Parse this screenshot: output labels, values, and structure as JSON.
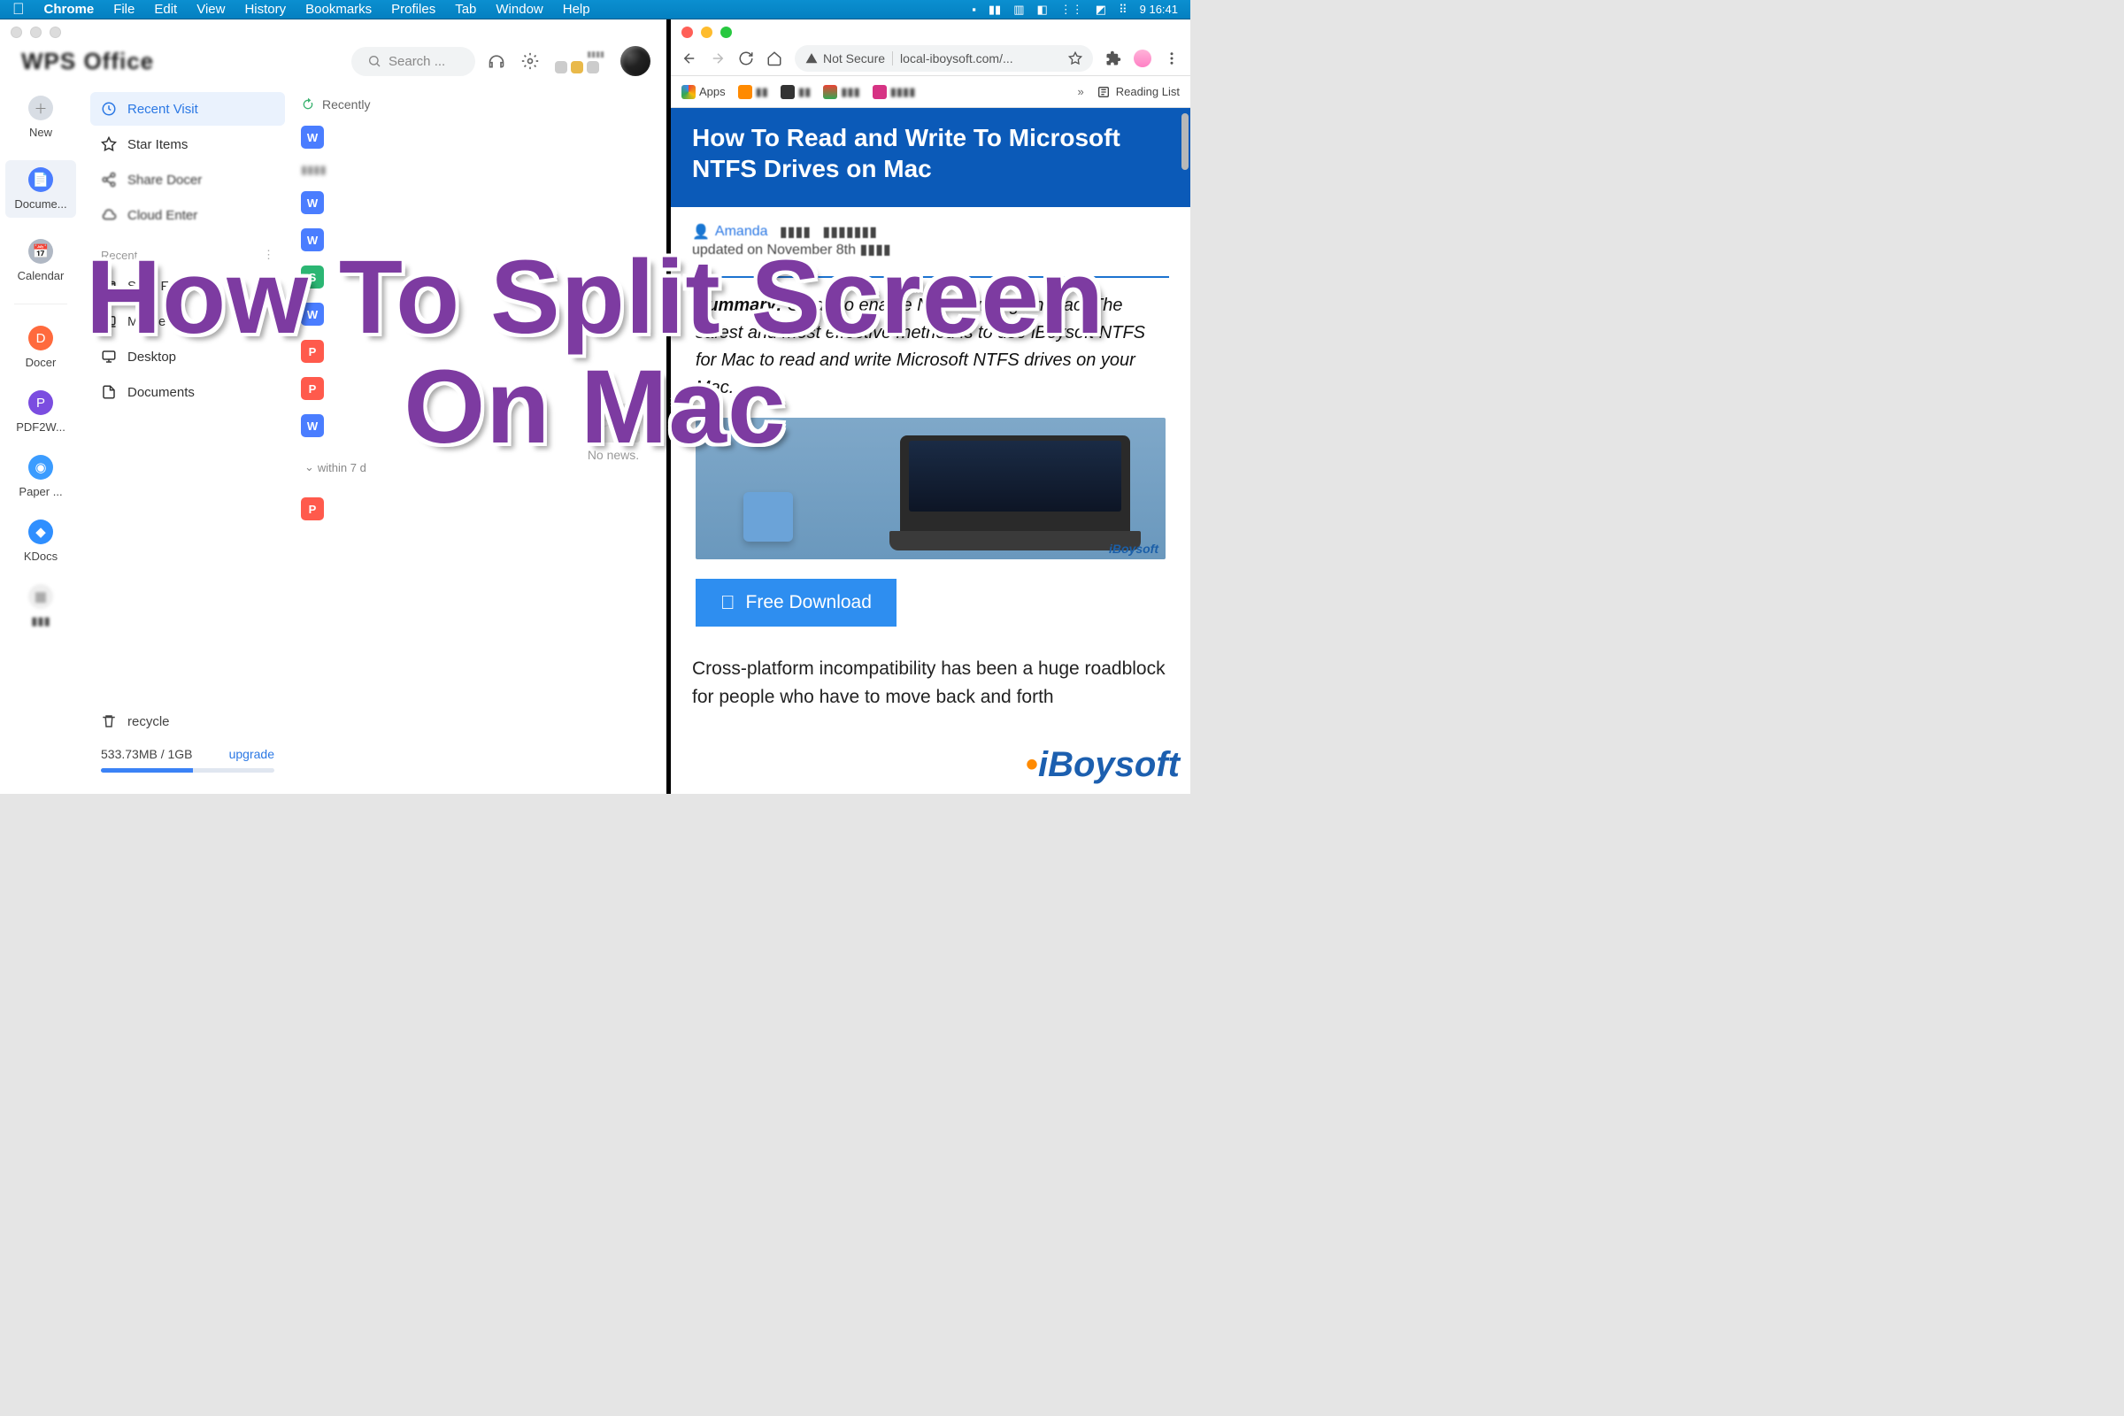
{
  "menubar": {
    "app": "Chrome",
    "items": [
      "File",
      "Edit",
      "View",
      "History",
      "Bookmarks",
      "Profiles",
      "Tab",
      "Window",
      "Help"
    ],
    "clock": "9 16:41"
  },
  "left": {
    "logo": "WPS Office",
    "search_placeholder": "Search ...",
    "cola": {
      "new": "New",
      "doc": "Docume...",
      "cal": "Calendar",
      "docer": "Docer",
      "pdf": "PDF2W...",
      "paper": "Paper ...",
      "kdocs": "KDocs"
    },
    "colb": {
      "recent_visit": "Recent Visit",
      "star": "Star Items",
      "share": "Share",
      "cloud": "Cloud",
      "section_recent": "Recent",
      "sync_folder": "Sync Folder",
      "my_device": "My Device",
      "desktop": "Desktop",
      "documents": "Documents",
      "recycle": "recycle",
      "storage": "533.73MB / 1GB",
      "upgrade": "upgrade"
    },
    "colc": {
      "recently": "Recently",
      "no_news": "No news.",
      "within_7": "within 7 d"
    }
  },
  "right": {
    "omnibox": {
      "not_secure": "Not Secure",
      "url": "local-iboysoft.com/..."
    },
    "bookmarks": {
      "apps": "Apps",
      "reading_list": "Reading List"
    },
    "page": {
      "h1": "How To Read and Write To Microsoft NTFS Drives on Mac",
      "author": "Amanda",
      "updated": "updated on November 8th",
      "summary_label": "Summary:",
      "summary": "Guide to enable NTFS writing on Mac. The safest and most effective method is to use iBoysoft NTFS for Mac to read and write Microsoft NTFS drives on your Mac.",
      "download": "Free Download",
      "cross": "Cross-platform incompatibility has been a huge roadblock for people who have to move back and forth"
    }
  },
  "overlay": {
    "line1": "How To Split Screen",
    "line2": "On Mac"
  },
  "watermark": "iBoysoft"
}
